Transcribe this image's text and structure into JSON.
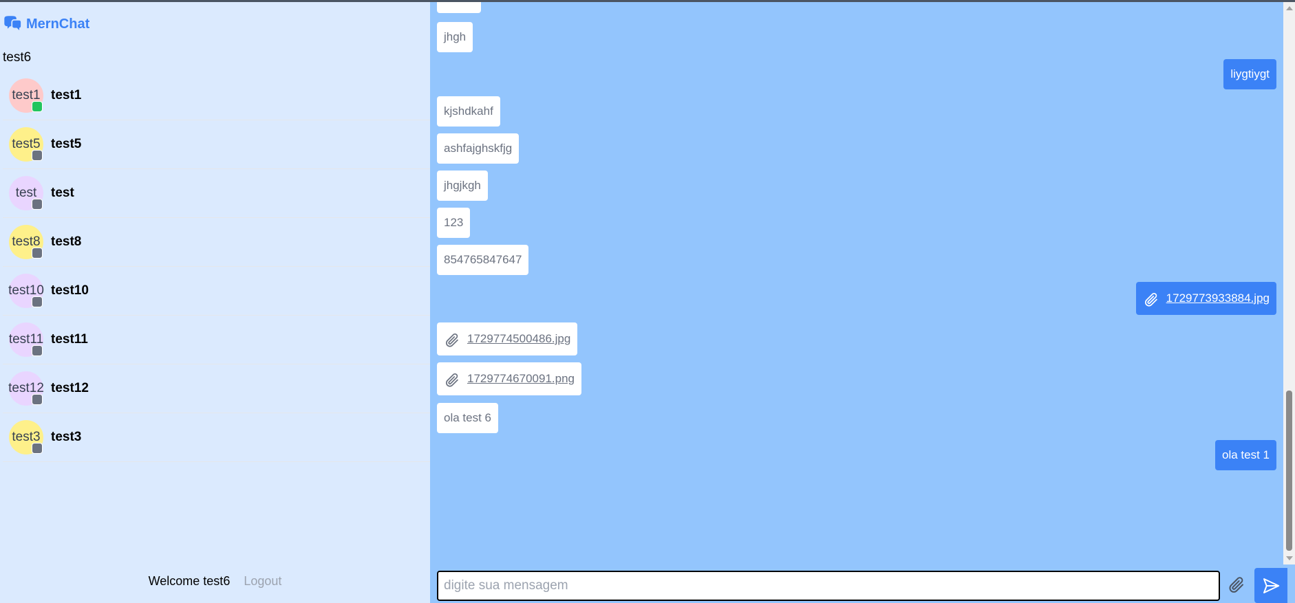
{
  "app": {
    "name": "MernChat"
  },
  "sidebar": {
    "current_user": "test6",
    "contacts": [
      {
        "avatar": "test1",
        "name": "test1",
        "online": true,
        "color": "#fecaca"
      },
      {
        "avatar": "test5",
        "name": "test5",
        "online": false,
        "color": "#fef08a"
      },
      {
        "avatar": "test",
        "name": "test",
        "online": false,
        "color": "#e9d5ff"
      },
      {
        "avatar": "test8",
        "name": "test8",
        "online": false,
        "color": "#fef08a"
      },
      {
        "avatar": "test10",
        "name": "test10",
        "online": false,
        "color": "#e9d5ff"
      },
      {
        "avatar": "test11",
        "name": "test11",
        "online": false,
        "color": "#e9d5ff"
      },
      {
        "avatar": "test12",
        "name": "test12",
        "online": false,
        "color": "#e9d5ff"
      },
      {
        "avatar": "test3",
        "name": "test3",
        "online": false,
        "color": "#fef08a"
      }
    ],
    "welcome": "Welcome test6",
    "logout": "Logout"
  },
  "chat": {
    "messages": [
      {
        "text": "jhgh",
        "from_me": false
      },
      {
        "text": "liygtiygt",
        "from_me": true
      },
      {
        "text": "kjshdkahf",
        "from_me": false
      },
      {
        "text": "ashfajghskfjg",
        "from_me": false
      },
      {
        "text": "jhgjkgh",
        "from_me": false
      },
      {
        "text": "123",
        "from_me": false
      },
      {
        "text": "854765847647",
        "from_me": false
      },
      {
        "file": "1729773933884.jpg",
        "from_me": true
      },
      {
        "file": "1729774500486.jpg",
        "from_me": false
      },
      {
        "file": "1729774670091.png",
        "from_me": false
      },
      {
        "text": "ola test 6",
        "from_me": false
      },
      {
        "text": "ola test 1",
        "from_me": true
      }
    ],
    "input_placeholder": "digite sua mensagem",
    "input_value": ""
  },
  "colors": {
    "accent": "#3b82f6",
    "sidebar_bg": "#dbeafe",
    "chat_bg": "#93c5fd",
    "online": "#22c55e",
    "offline": "#6b7280"
  }
}
